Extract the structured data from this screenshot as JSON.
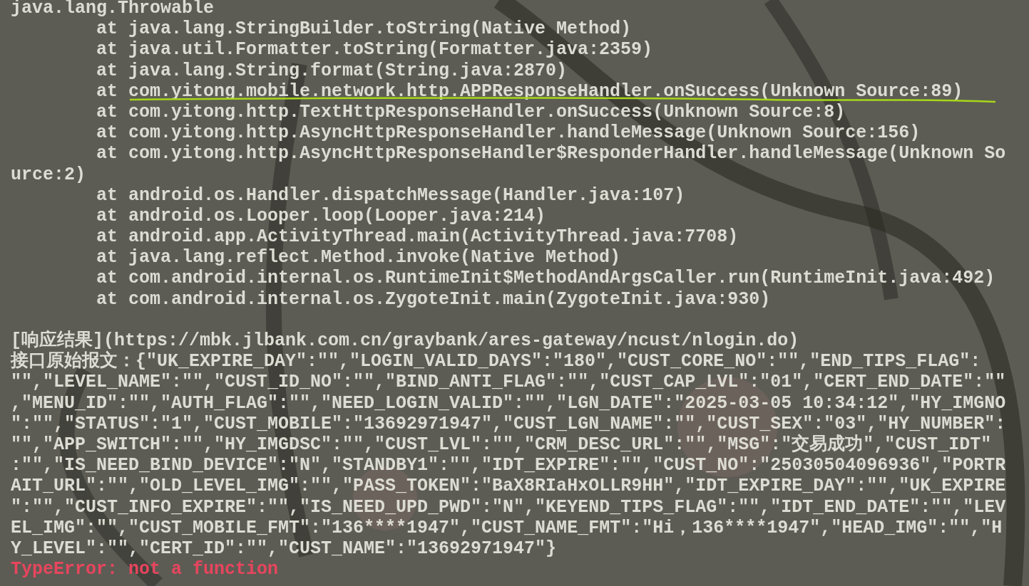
{
  "stack_trace": [
    {
      "kind": "plain",
      "text": "java.lang.Throwable",
      "underlined": false
    },
    {
      "kind": "frame",
      "text": "at java.lang.StringBuilder.toString(Native Method)",
      "underlined": false
    },
    {
      "kind": "frame",
      "text": "at java.util.Formatter.toString(Formatter.java:2359)",
      "underlined": false
    },
    {
      "kind": "frame",
      "text": "at java.lang.String.format(String.java:2870)",
      "underlined": false
    },
    {
      "kind": "frame",
      "text": "at com.yitong.mobile.network.http.APPResponseHandler.onSuccess(Unknown Source:89)",
      "underlined": true
    },
    {
      "kind": "frame",
      "text": "at com.yitong.http.TextHttpResponseHandler.onSuccess(Unknown Source:8)",
      "underlined": false
    },
    {
      "kind": "frame",
      "text": "at com.yitong.http.AsyncHttpResponseHandler.handleMessage(Unknown Source:156)",
      "underlined": false
    },
    {
      "kind": "frame",
      "text": "at com.yitong.http.AsyncHttpResponseHandler$ResponderHandler.handleMessage(Unknown So",
      "underlined": false
    },
    {
      "kind": "plain",
      "text": "urce:2)",
      "underlined": false
    },
    {
      "kind": "frame",
      "text": "at android.os.Handler.dispatchMessage(Handler.java:107)",
      "underlined": false
    },
    {
      "kind": "frame",
      "text": "at android.os.Looper.loop(Looper.java:214)",
      "underlined": false
    },
    {
      "kind": "frame",
      "text": "at android.app.ActivityThread.main(ActivityThread.java:7708)",
      "underlined": false
    },
    {
      "kind": "frame",
      "text": "at java.lang.reflect.Method.invoke(Native Method)",
      "underlined": false
    },
    {
      "kind": "frame",
      "text": "at com.android.internal.os.RuntimeInit$MethodAndArgsCaller.run(RuntimeInit.java:492)",
      "underlined": false
    },
    {
      "kind": "frame",
      "text": "at com.android.internal.os.ZygoteInit.main(ZygoteInit.java:930)",
      "underlined": false
    }
  ],
  "response": [
    {
      "kind": "plain",
      "text": "[响应结果](https://mbk.jlbank.com.cn/graybank/ares-gateway/ncust/nlogin.do)"
    },
    {
      "kind": "plain",
      "text": "接口原始报文：{\"UK_EXPIRE_DAY\":\"\",\"LOGIN_VALID_DAYS\":\"180\",\"CUST_CORE_NO\":\"\",\"END_TIPS_FLAG\":"
    },
    {
      "kind": "plain",
      "text": "\"\",\"LEVEL_NAME\":\"\",\"CUST_ID_NO\":\"\",\"BIND_ANTI_FLAG\":\"\",\"CUST_CAP_LVL\":\"01\",\"CERT_END_DATE\":\"\""
    },
    {
      "kind": "plain",
      "text": ",\"MENU_ID\":\"\",\"AUTH_FLAG\":\"\",\"NEED_LOGIN_VALID\":\"\",\"LGN_DATE\":\"2025-03-05 10:34:12\",\"HY_IMGNO"
    },
    {
      "kind": "plain",
      "text": "\":\"\",\"STATUS\":\"1\",\"CUST_MOBILE\":\"13692971947\",\"CUST_LGN_NAME\":\"\",\"CUST_SEX\":\"03\",\"HY_NUMBER\":"
    },
    {
      "kind": "plain",
      "text": "\"\",\"APP_SWITCH\":\"\",\"HY_IMGDSC\":\"\",\"CUST_LVL\":\"\",\"CRM_DESC_URL\":\"\",\"MSG\":\"交易成功\",\"CUST_IDT\""
    },
    {
      "kind": "plain",
      "text": ":\"\",\"IS_NEED_BIND_DEVICE\":\"N\",\"STANDBY1\":\"\",\"IDT_EXPIRE\":\"\",\"CUST_NO\":\"25030504096936\",\"PORTR"
    },
    {
      "kind": "plain",
      "text": "AIT_URL\":\"\",\"OLD_LEVEL_IMG\":\"\",\"PASS_TOKEN\":\"BaX8RIaHxOLLR9HH\",\"IDT_EXPIRE_DAY\":\"\",\"UK_EXPIRE"
    },
    {
      "kind": "plain",
      "text": "\":\"\",\"CUST_INFO_EXPIRE\":\"\",\"IS_NEED_UPD_PWD\":\"N\",\"KEYEND_TIPS_FLAG\":\"\",\"IDT_END_DATE\":\"\",\"LEV"
    },
    {
      "kind": "plain",
      "text": "EL_IMG\":\"\",\"CUST_MOBILE_FMT\":\"136****1947\",\"CUST_NAME_FMT\":\"Hi，136****1947\",\"HEAD_IMG\":\"\",\"H"
    },
    {
      "kind": "plain",
      "text": "Y_LEVEL\":\"\",\"CERT_ID\":\"\",\"CUST_NAME\":\"13692971947\"}"
    },
    {
      "kind": "error",
      "text": "TypeError: not a function"
    }
  ]
}
